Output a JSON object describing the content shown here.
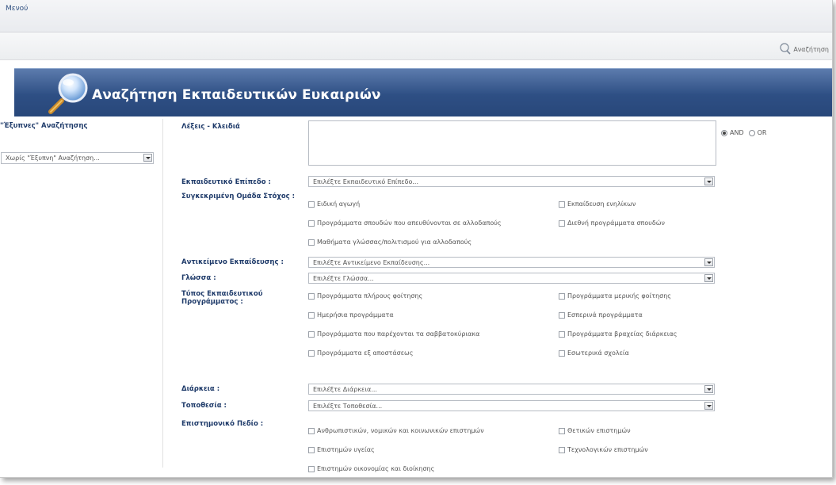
{
  "menu": {
    "label": "Μενού"
  },
  "toolbar": {
    "search_link": "Αναζήτηση"
  },
  "banner": {
    "title": "Αναζήτηση Εκπαιδευτικών Ευκαιριών"
  },
  "sidebar": {
    "header": "\"Έξυπνες\" Αναζήτησης",
    "select_value": "Χωρίς \"Έξυπνη\" Αναζήτηση..."
  },
  "form": {
    "keywords_label": "Λέξεις - Κλειδιά",
    "operator": {
      "and_label": "AND",
      "or_label": "OR",
      "selected": "AND"
    },
    "education_level": {
      "label": "Εκπαιδευτικό Επίπεδο :",
      "value": "Επιλέξτε Εκπαιδευτικό Επίπεδο..."
    },
    "target_group": {
      "label": "Συγκεκριμένη Ομάδα Στόχος :",
      "options": [
        "Ειδική αγωγή",
        "Εκπαίδευση ενηλίκων",
        "Προγράμματα σπουδών που απευθύνονται σε αλλοδαπούς",
        "Διεθνή προγράμματα σπουδών",
        "Μαθήματα γλώσσας/πολιτισμού για αλλοδαπούς"
      ]
    },
    "education_subject": {
      "label": "Αντικείμενο Εκπαίδευσης :",
      "value": "Επιλέξτε Αντικείμενο Εκπαίδευσης..."
    },
    "language": {
      "label": "Γλώσσα :",
      "value": "Επιλέξτε Γλώσσα..."
    },
    "program_type": {
      "label_line1": "Τύπος Εκπαιδευτικού",
      "label_line2": "Προγράμματος :",
      "options": [
        "Προγράμματα πλήρους φοίτησης",
        "Προγράμματα μερικής φοίτησης",
        "Ημερήσια προγράμματα",
        "Εσπερινά προγράμματα",
        "Προγράμματα που παρέχονται τα σαββατοκύριακα",
        "Προγράμματα βραχείας διάρκειας",
        "Προγράμματα εξ αποστάσεως",
        "Εσωτερικά σχολεία"
      ]
    },
    "duration": {
      "label": "Διάρκεια :",
      "value": "Επιλέξτε Διάρκεια..."
    },
    "location": {
      "label": "Τοποθεσία :",
      "value": "Επιλέξτε Τοποθεσία..."
    },
    "scientific_field": {
      "label": "Επιστημονικό Πεδίο :",
      "options": [
        "Ανθρωπιστικών, νομικών και κοινωνικών επιστημών",
        "Θετικών επιστημών",
        "Επιστημών υγείας",
        "Τεχνολογικών επιστημών",
        "Επιστημών οικονομίας και διοίκησης"
      ]
    }
  },
  "colors": {
    "banner": "#2e4f84",
    "label": "#1f3b6a"
  }
}
